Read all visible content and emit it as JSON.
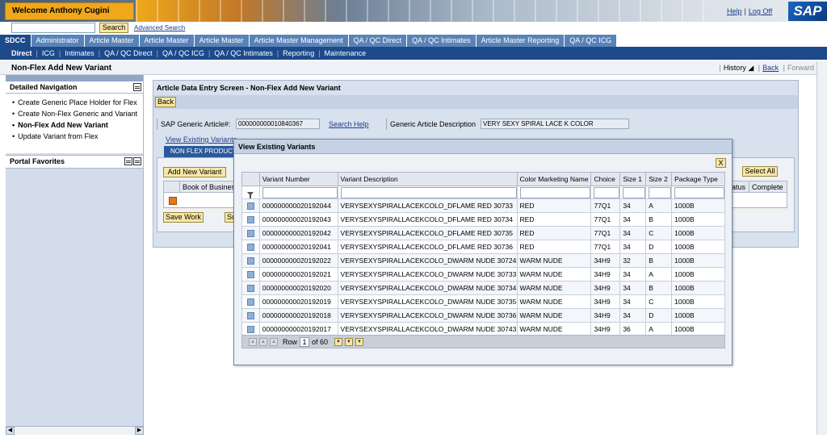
{
  "masthead": {
    "welcome": "Welcome Anthony Cugini",
    "help": "Help",
    "logoff": "Log Off",
    "logo": "SAP"
  },
  "search": {
    "value": "",
    "button": "Search",
    "advanced": "Advanced Search"
  },
  "topnav": [
    "SDCC",
    "Administrator",
    "Article Master",
    "Article Master",
    "Article Master",
    "Article Master Management",
    "QA / QC Direct",
    "QA / QC Intimates",
    "Article Master Reporting",
    "QA / QC ICG"
  ],
  "subnav": [
    "Direct",
    "ICG",
    "Intimates",
    "QA / QC Direct",
    "QA / QC ICG",
    "QA / QC Intimates",
    "Reporting",
    "Maintenance"
  ],
  "page": {
    "title": "Non-Flex Add New Variant",
    "history": "History",
    "back": "Back",
    "forward": "Forward"
  },
  "left_panel": {
    "detailed_navigation": "Detailed Navigation",
    "items": [
      "Create Generic Place Holder for Flex",
      "Create Non-Flex Generic and Variant",
      "Non-Flex Add New Variant",
      "Update Variant from Flex"
    ],
    "portal_favorites": "Portal Favorites"
  },
  "main": {
    "title": "Article Data Entry Screen - Non-Flex Add New Variant",
    "back_button": "Back",
    "generic_article_label": "SAP Generic Article#:",
    "generic_article_value": "000000000010840367",
    "search_help": "Search Help",
    "generic_desc_label": "Generic Article Description",
    "generic_desc_value": "VERY SEXY SPIRAL LACE K COLOR",
    "view_variants_link": "View Existing Variants",
    "tab_label": "NON FLEX PRODUCT",
    "add_variant": "Add New Variant",
    "select_all": "Select All",
    "bg_col_book": "Book of Busines",
    "bg_col_status": "atus",
    "bg_col_complete": "Complete",
    "save_work": "Save Work",
    "submit": "Su"
  },
  "popup": {
    "title": "View Existing Variants",
    "close": "X",
    "columns": [
      "Variant Number",
      "Variant Description",
      "Color Marketing Name",
      "Choice",
      "Size 1",
      "Size 2",
      "Package Type"
    ],
    "rows": [
      [
        "000000000020192044",
        "VERYSEXYSPIRALLACEKCOLO_DFLAME RED 30733",
        "RED",
        "77Q1",
        "34",
        "A",
        "1000B"
      ],
      [
        "000000000020192043",
        "VERYSEXYSPIRALLACEKCOLO_DFLAME RED 30734",
        "RED",
        "77Q1",
        "34",
        "B",
        "1000B"
      ],
      [
        "000000000020192042",
        "VERYSEXYSPIRALLACEKCOLO_DFLAME RED 30735",
        "RED",
        "77Q1",
        "34",
        "C",
        "1000B"
      ],
      [
        "000000000020192041",
        "VERYSEXYSPIRALLACEKCOLO_DFLAME RED 30736",
        "RED",
        "77Q1",
        "34",
        "D",
        "1000B"
      ],
      [
        "000000000020192022",
        "VERYSEXYSPIRALLACEKCOLO_DWARM NUDE 30724",
        "WARM NUDE",
        "34H9",
        "32",
        "B",
        "1000B"
      ],
      [
        "000000000020192021",
        "VERYSEXYSPIRALLACEKCOLO_DWARM NUDE 30733",
        "WARM NUDE",
        "34H9",
        "34",
        "A",
        "1000B"
      ],
      [
        "000000000020192020",
        "VERYSEXYSPIRALLACEKCOLO_DWARM NUDE 30734",
        "WARM NUDE",
        "34H9",
        "34",
        "B",
        "1000B"
      ],
      [
        "000000000020192019",
        "VERYSEXYSPIRALLACEKCOLO_DWARM NUDE 30735",
        "WARM NUDE",
        "34H9",
        "34",
        "C",
        "1000B"
      ],
      [
        "000000000020192018",
        "VERYSEXYSPIRALLACEKCOLO_DWARM NUDE 30736",
        "WARM NUDE",
        "34H9",
        "34",
        "D",
        "1000B"
      ],
      [
        "000000000020192017",
        "VERYSEXYSPIRALLACEKCOLO_DWARM NUDE 30743",
        "WARM NUDE",
        "34H9",
        "36",
        "A",
        "1000B"
      ]
    ],
    "pager": {
      "row_label": "Row",
      "row_value": "1",
      "of_label": "of 60"
    }
  },
  "colors": {
    "nav_blue": "#1c4a8a",
    "tab_blue": "#5883b8",
    "button_yellow": "#f7e7a6",
    "welcome_orange": "#f0a81a"
  },
  "icons": {
    "filter": "funnel-icon",
    "selector": "row-selector-icon",
    "menu": "panel-menu-icon"
  }
}
